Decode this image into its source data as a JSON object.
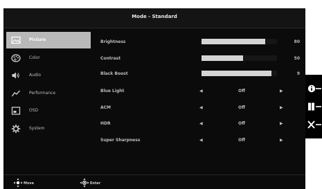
{
  "title": "Mode - Standard",
  "sidebar": {
    "items": [
      {
        "label": "Picture",
        "icon": "picture-icon",
        "selected": true
      },
      {
        "label": "Color",
        "icon": "palette-icon",
        "selected": false
      },
      {
        "label": "Audio",
        "icon": "speaker-icon",
        "selected": false
      },
      {
        "label": "Performance",
        "icon": "performance-icon",
        "selected": false
      },
      {
        "label": "OSD",
        "icon": "osd-icon",
        "selected": false
      },
      {
        "label": "System",
        "icon": "gear-icon",
        "selected": false
      }
    ]
  },
  "settings": {
    "brightness": {
      "label": "Brightness",
      "value": "80"
    },
    "contrast": {
      "label": "Contrast",
      "value": "50"
    },
    "black_boost": {
      "label": "Black Boost",
      "value": "9"
    },
    "blue_light": {
      "label": "Blue Light",
      "value": "Off"
    },
    "acm": {
      "label": "ACM",
      "value": "Off"
    },
    "hdr": {
      "label": "HDR",
      "value": "Off"
    },
    "super_sharpness": {
      "label": "Super Sharpness",
      "value": "Off"
    }
  },
  "slider_levels": {
    "brightness": 0.84,
    "contrast": 0.55,
    "black_boost": 0.93
  },
  "footer": {
    "move_label": "Move",
    "enter_label": "Enter"
  },
  "hardware_buttons": [
    "info-icon",
    "input-icon",
    "close-icon"
  ],
  "colors": {
    "background": "#0b0b0b",
    "selected": "#b9b9b9",
    "text": "#bdbdbd",
    "bar": "#d4d4d4"
  }
}
